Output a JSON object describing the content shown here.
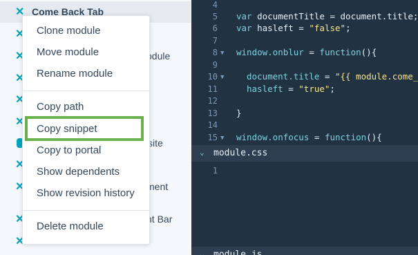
{
  "sidebar": {
    "active_item_label": "Come Back Tab",
    "partial_labels": [
      "odule",
      "site",
      "ment",
      "nt Bar"
    ]
  },
  "menu": {
    "items": [
      "Clone module",
      "Move module",
      "Rename module",
      "Copy path",
      "Copy snippet",
      "Copy to portal",
      "Show dependents",
      "Show revision history",
      "Delete module"
    ],
    "highlighted_item": "Copy snippet"
  },
  "editor": {
    "line_numbers": [
      "4",
      "5",
      "6",
      "7",
      "8",
      "9",
      "10",
      "11",
      "12",
      "13",
      "14",
      "15"
    ],
    "code": {
      "l5_kw": "var",
      "l5_rest": " documentTitle = document.title;",
      "l6_kw": "var",
      "l6_rest": " hasleft = ",
      "l6_str": "\"false\"",
      "l6_end": ";",
      "l8_a": "window.onblur",
      "l8_b": " = ",
      "l8_c": "function",
      "l8_d": "(){",
      "l10_a": "document.title",
      "l10_b": " = ",
      "l10_c": "\"{{ module.come_ba",
      "l11_a": "hasleft",
      "l11_b": " = ",
      "l11_c": "\"true\"",
      "l11_d": ";",
      "l13": "}",
      "l15_a": "window.onfocus",
      "l15_b": " = ",
      "l15_c": "function",
      "l15_d": "(){"
    },
    "css_panel_title": "module.css",
    "css_line_numbers": [
      "1"
    ],
    "js_panel_title": "module.js"
  },
  "colors": {
    "accent": "#00a4bd",
    "highlight": "#6ab04c",
    "editor_bg": "#213343"
  }
}
